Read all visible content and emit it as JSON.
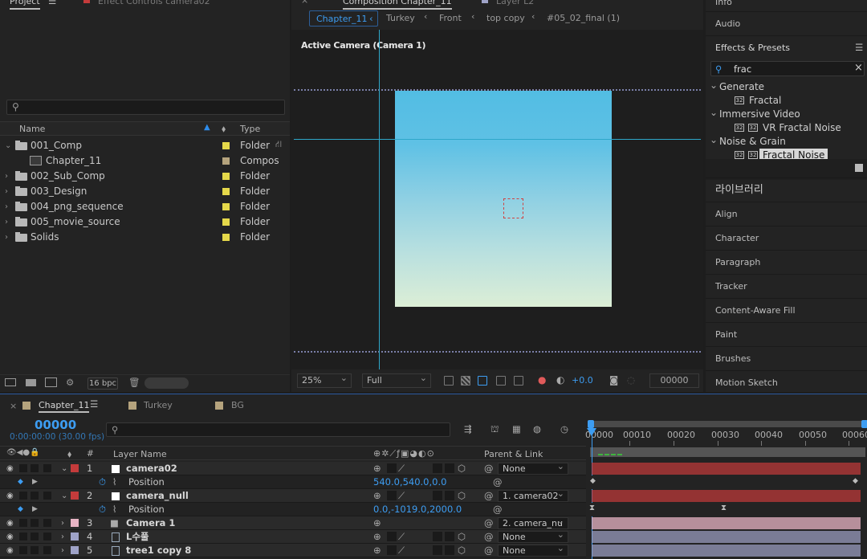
{
  "colors": {
    "accent": "#2d8ceb",
    "timecode": "#3d9df2",
    "folder_label": "#e5d84a",
    "camera_label": "#c43b3b"
  },
  "project": {
    "tab": "Project",
    "tab2": "Effect Controls camera02",
    "col_name": "Name",
    "col_type": "Type",
    "items": [
      {
        "name": "001_Comp",
        "type": "Folder",
        "kind": "folder",
        "expanded": true
      },
      {
        "name": "Chapter_11",
        "type": "Compos",
        "kind": "comp"
      },
      {
        "name": "002_Sub_Comp",
        "type": "Folder",
        "kind": "folder"
      },
      {
        "name": "003_Design",
        "type": "Folder",
        "kind": "folder"
      },
      {
        "name": "004_png_sequence",
        "type": "Folder",
        "kind": "folder"
      },
      {
        "name": "005_movie_source",
        "type": "Folder",
        "kind": "folder"
      },
      {
        "name": "Solids",
        "type": "Folder",
        "kind": "folder"
      }
    ],
    "bpc": "16 bpc"
  },
  "comp": {
    "tab": "Composition Chapter_11",
    "tab2": "Layer L2",
    "breadcrumbs": [
      "Chapter_11",
      "Turkey",
      "Front",
      "top copy",
      "#05_02_final (1)"
    ],
    "active_camera": "Active Camera (Camera 1)",
    "zoom": "25%",
    "resolution": "Full",
    "exposure": "+0.0",
    "timecode": "00000"
  },
  "right": {
    "info": "Info",
    "audio": "Audio",
    "effects": "Effects & Presets",
    "search_value": "frac",
    "tree": [
      {
        "label": "Generate",
        "level": 0
      },
      {
        "label": "Fractal",
        "level": 1
      },
      {
        "label": "Immersive Video",
        "level": 0
      },
      {
        "label": "VR Fractal Noise",
        "level": 1
      },
      {
        "label": "Noise & Grain",
        "level": 0
      },
      {
        "label": "Fractal Noise",
        "level": 1,
        "selected": true
      }
    ],
    "panels": [
      "라이브러리",
      "Align",
      "Character",
      "Paragraph",
      "Tracker",
      "Content-Aware Fill",
      "Paint",
      "Brushes",
      "Motion Sketch"
    ]
  },
  "timeline": {
    "tabs": [
      "Chapter_11",
      "Turkey",
      "BG"
    ],
    "timecode": "00000",
    "subtime": "0:00:00:00 (30.00 fps)",
    "col_layer": "Layer Name",
    "col_parent": "Parent & Link",
    "col_num": "#",
    "ruler": [
      "00000",
      "00010",
      "00020",
      "00030",
      "00040",
      "00050",
      "00060"
    ],
    "layers": [
      {
        "num": "1",
        "name": "camera02",
        "parent": "None",
        "color": "#c43b3b"
      },
      {
        "prop": "Position",
        "value": "540.0,540.0,0.0"
      },
      {
        "num": "2",
        "name": "camera_null",
        "parent": "1. camera02",
        "color": "#c43b3b"
      },
      {
        "prop": "Position",
        "value": "0.0,-1019.0,2000.0"
      },
      {
        "num": "3",
        "name": "Camera 1",
        "parent": "2. camera_nu",
        "color": "#e8b4c4"
      },
      {
        "num": "4",
        "name": "L수풀",
        "parent": "None",
        "color": "#9fa3c8"
      },
      {
        "num": "5",
        "name": "tree1 copy 8",
        "parent": "None",
        "color": "#9fa3c8"
      }
    ]
  }
}
